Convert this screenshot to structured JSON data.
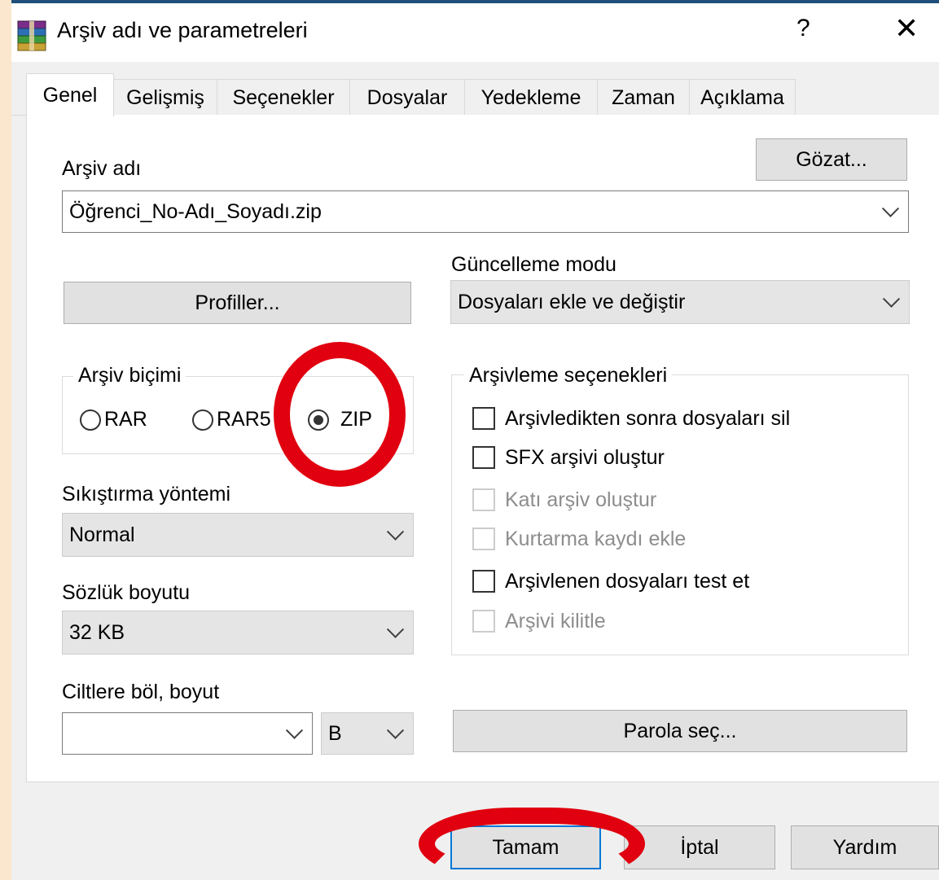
{
  "window": {
    "title": "Arşiv adı ve parametreleri",
    "help": "?",
    "close": "✕",
    "icon": "winrar-books-icon"
  },
  "tabs": [
    "Genel",
    "Gelişmiş",
    "Seçenekler",
    "Dosyalar",
    "Yedekleme",
    "Zaman",
    "Açıklama"
  ],
  "archive_name": {
    "label": "Arşiv adı",
    "value": "Öğrenci_No-Adı_Soyadı.zip",
    "browse_label": "Gözat..."
  },
  "profiles_label": "Profiller...",
  "update_mode": {
    "label": "Güncelleme modu",
    "value": "Dosyaları ekle ve değiştir"
  },
  "archive_format": {
    "title": "Arşiv biçimi",
    "options": [
      "RAR",
      "RAR5",
      "ZIP"
    ],
    "selected": "ZIP"
  },
  "compression": {
    "label": "Sıkıştırma yöntemi",
    "value": "Normal"
  },
  "dictionary": {
    "label": "Sözlük boyutu",
    "value": "32 KB"
  },
  "split": {
    "label": "Ciltlere böl, boyut",
    "value": "",
    "unit": "B"
  },
  "archiving_options": {
    "title": "Arşivleme seçenekleri",
    "items": [
      {
        "label": "Arşivledikten sonra dosyaları sil",
        "enabled": true,
        "checked": false
      },
      {
        "label": "SFX arşivi oluştur",
        "enabled": true,
        "checked": false
      },
      {
        "label": "Katı arşiv oluştur",
        "enabled": false,
        "checked": false
      },
      {
        "label": "Kurtarma kaydı ekle",
        "enabled": false,
        "checked": false
      },
      {
        "label": "Arşivlenen dosyaları test et",
        "enabled": true,
        "checked": false
      },
      {
        "label": "Arşivi kilitle",
        "enabled": false,
        "checked": false
      }
    ]
  },
  "password_label": "Parola seç...",
  "footer": {
    "ok": "Tamam",
    "cancel": "İptal",
    "help": "Yardım"
  },
  "annotation_color": "#e0000f"
}
